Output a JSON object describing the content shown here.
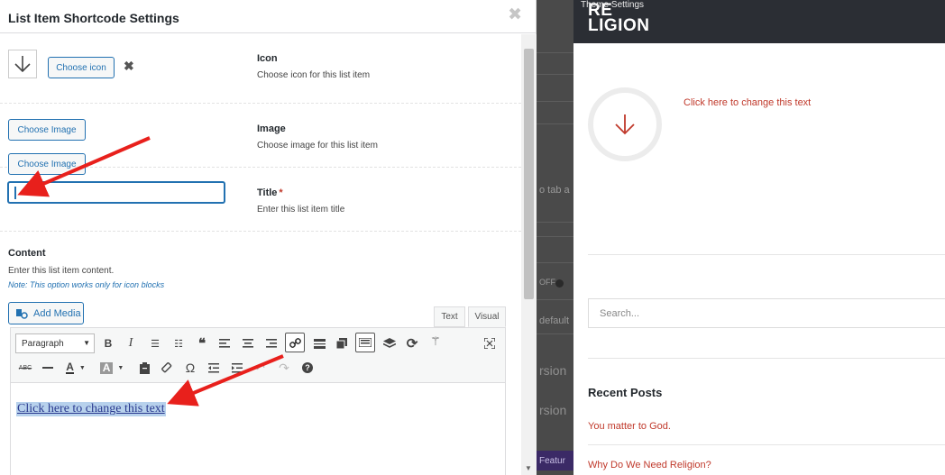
{
  "modal": {
    "title": "List Item Shortcode Settings",
    "close_glyph": "✖",
    "icon_field": {
      "label": "Icon",
      "description": "Choose icon for this list item",
      "button": "Choose icon",
      "remove_glyph": "✖"
    },
    "image_field": {
      "label": "Image",
      "description": "Choose image for this list item",
      "button": "Choose Image"
    },
    "title_field": {
      "label": "Title",
      "required_mark": "*",
      "description": "Enter this list item title",
      "value": ""
    },
    "content_field": {
      "label": "Content",
      "description": "Enter this list item content.",
      "note": "Note: This option works only for icon blocks",
      "add_media": "Add Media",
      "tabs": [
        "Text",
        "Visual"
      ],
      "format_select": "Paragraph",
      "content_text": "Click here to change this text"
    }
  },
  "admin_background": {
    "texts": [
      "o tab a",
      "OFF",
      "default",
      "rsion",
      "rsion",
      "Featur"
    ]
  },
  "preview": {
    "site_logo_top": "RE",
    "site_logo_bottom": "LIGION",
    "theme_settings": "Theme Settings",
    "list_item_text": "Click here to change this text",
    "search_placeholder": "Search...",
    "recent_posts_title": "Recent Posts",
    "recent_posts": [
      "You matter to God.",
      "Why Do We Need Religion?"
    ]
  },
  "colors": {
    "accent_blue": "#2271b1",
    "preview_link": "#c0392b",
    "header_dark": "#2b2e34",
    "arrow_red": "#e8201c"
  }
}
